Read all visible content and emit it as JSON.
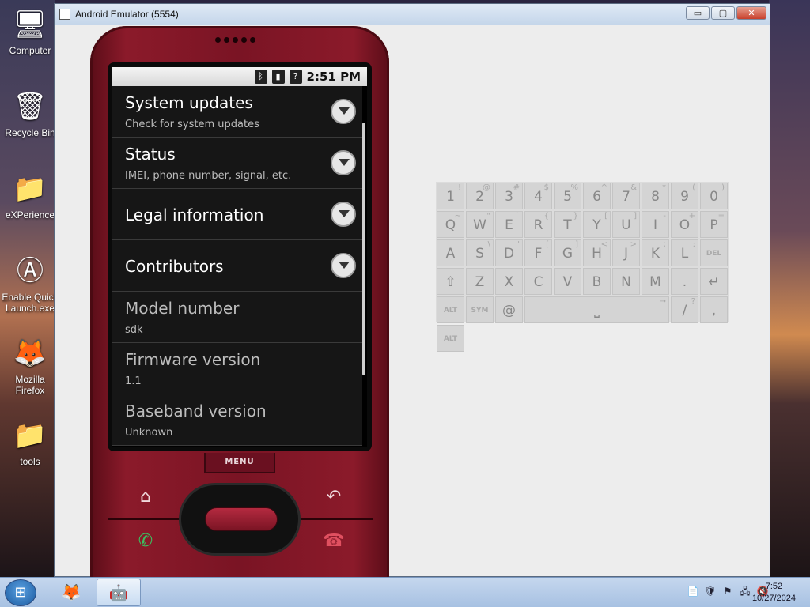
{
  "desktop": {
    "icons": [
      {
        "label": "Computer",
        "glyph": "🖥"
      },
      {
        "label": "Recycle Bin",
        "glyph": "🗑"
      },
      {
        "label": "eXPerience",
        "glyph": "📁"
      },
      {
        "label": "Enable Quick Launch.exe",
        "glyph": "Ⓐ"
      },
      {
        "label": "Mozilla Firefox",
        "glyph": "🦊"
      },
      {
        "label": "tools",
        "glyph": "📁"
      }
    ]
  },
  "window": {
    "title": "Android Emulator (5554)",
    "minimize": "▭",
    "maximize": "▢",
    "close": "✕"
  },
  "phone": {
    "status": {
      "bluetooth": "ᛒ",
      "signal": "▮",
      "unknown": "?",
      "time": "2:51 PM"
    },
    "settings": [
      {
        "title": "System updates",
        "subtitle": "Check for system updates"
      },
      {
        "title": "Status",
        "subtitle": "IMEI, phone number, signal, etc."
      },
      {
        "title": "Legal information",
        "subtitle": ""
      },
      {
        "title": "Contributors",
        "subtitle": ""
      },
      {
        "title": "Model number",
        "subtitle": "sdk"
      },
      {
        "title": "Firmware version",
        "subtitle": "1.1"
      },
      {
        "title": "Baseband version",
        "subtitle": "Unknown"
      }
    ],
    "menu_label": "MENU",
    "home_glyph": "⌂",
    "back_glyph": "↶",
    "call_glyph": "✆",
    "end_glyph": "☎"
  },
  "keyboard": {
    "rows": [
      [
        [
          "1",
          "!"
        ],
        [
          "2",
          "@"
        ],
        [
          "3",
          "#"
        ],
        [
          "4",
          "$"
        ],
        [
          "5",
          "%"
        ],
        [
          "6",
          "^"
        ],
        [
          "7",
          "&"
        ],
        [
          "8",
          "*"
        ],
        [
          "9",
          "("
        ],
        [
          "0",
          ")"
        ]
      ],
      [
        [
          "Q",
          "~"
        ],
        [
          "W",
          "\""
        ],
        [
          "E",
          "`"
        ],
        [
          "R",
          "{"
        ],
        [
          "T",
          "}"
        ],
        [
          "Y",
          "["
        ],
        [
          "U",
          "]"
        ],
        [
          "I",
          "-"
        ],
        [
          "O",
          "+"
        ],
        [
          "P",
          "="
        ]
      ],
      [
        [
          "A",
          ""
        ],
        [
          "S",
          "\\"
        ],
        [
          "D",
          "'"
        ],
        [
          "F",
          "["
        ],
        [
          "G",
          "]"
        ],
        [
          "H",
          "<"
        ],
        [
          "J",
          ">"
        ],
        [
          "K",
          ";"
        ],
        [
          "L",
          ":"
        ],
        [
          "DEL",
          ""
        ]
      ],
      [
        [
          "⇧",
          ""
        ],
        [
          "Z",
          ""
        ],
        [
          "X",
          ""
        ],
        [
          "C",
          ""
        ],
        [
          "V",
          ""
        ],
        [
          "B",
          ""
        ],
        [
          "N",
          ""
        ],
        [
          "M",
          ""
        ],
        [
          ".",
          ""
        ],
        [
          "↵",
          ""
        ]
      ],
      [
        [
          "ALT",
          ""
        ],
        [
          "SYM",
          ""
        ],
        [
          "@",
          ""
        ],
        [
          "⎵",
          "→"
        ],
        [
          "/",
          "?"
        ],
        [
          ",",
          ""
        ],
        [
          "ALT",
          ""
        ]
      ]
    ]
  },
  "taskbar": {
    "firefox_glyph": "🦊",
    "android_glyph": "🤖",
    "tray": [
      "📄",
      "🛡",
      "⚑",
      "🖧",
      "🔇"
    ],
    "time": "7:52",
    "date": "10/27/2024"
  }
}
